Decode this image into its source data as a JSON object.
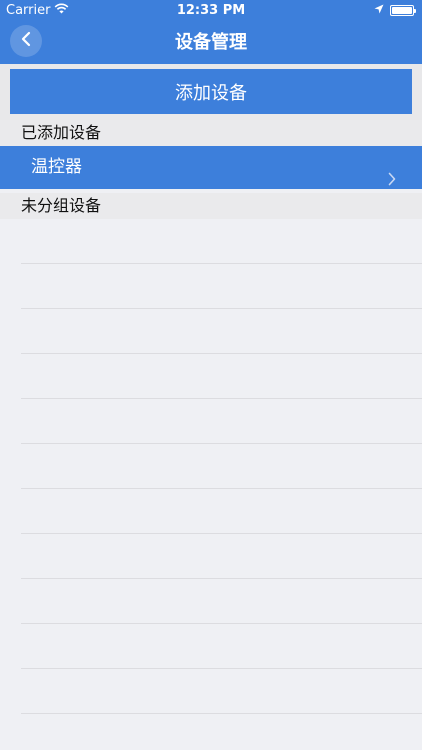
{
  "status_bar": {
    "carrier": "Carrier",
    "time": "12:33 PM"
  },
  "nav": {
    "title": "设备管理",
    "back_icon": "chevron-left-icon"
  },
  "add_button": {
    "label": "添加设备"
  },
  "added_section": {
    "header": "已添加设备",
    "items": [
      {
        "label": "温控器",
        "icon": "chevron-right-icon"
      }
    ]
  },
  "ungrouped_section": {
    "header": "未分组设备",
    "items": []
  },
  "colors": {
    "accent": "#3d7fdb",
    "background": "#eff0f4",
    "section_bg": "#eaeaec"
  }
}
